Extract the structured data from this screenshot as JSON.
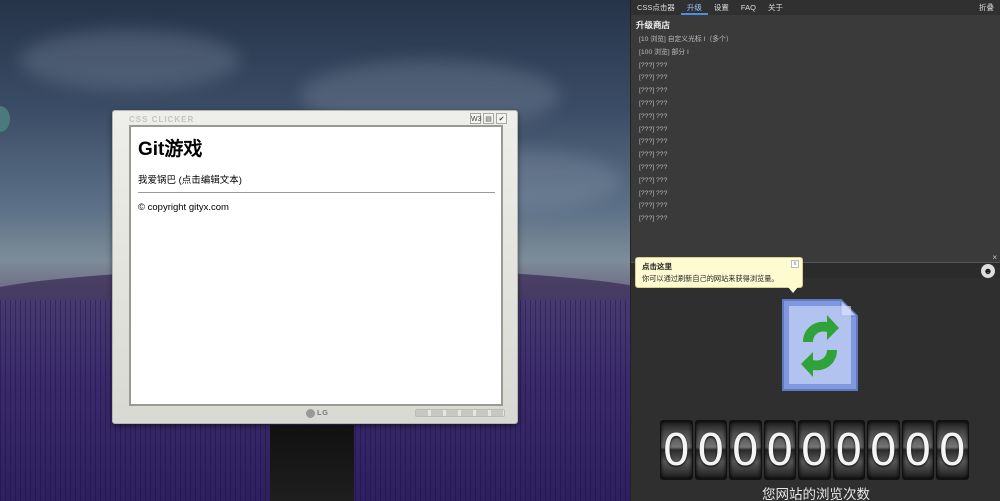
{
  "tabs": [
    {
      "label": "CSS点击器",
      "active": false
    },
    {
      "label": "升级",
      "active": true
    },
    {
      "label": "设置",
      "active": false
    },
    {
      "label": "FAQ",
      "active": false
    },
    {
      "label": "关于",
      "active": false
    }
  ],
  "collapse_label": "折叠",
  "store_title": "升级商店",
  "upgrades": [
    "[10 浏览] 自定义光标 I（多个）",
    "[100 浏览] 部分 I",
    "[???] ???",
    "[???] ???",
    "[???] ???",
    "[???] ???",
    "[???] ???",
    "[???] ???",
    "[???] ???",
    "[???] ???",
    "[???] ???",
    "[???] ???",
    "[???] ???",
    "[???] ???",
    "[???] ???"
  ],
  "monitor": {
    "brand": "CSS CLICKER",
    "logo": "LG",
    "corner_icons": [
      "W3",
      "doc-icon",
      "check-icon"
    ]
  },
  "website": {
    "title": "Git游戏",
    "editable_text": "我爱锅巴 (点击编辑文本)",
    "footer": "© copyright gityx.com"
  },
  "tooltip": {
    "title": "点击这里",
    "body": "你可以通过刷新自己的网站来获得浏览量。",
    "close": "x"
  },
  "counter": {
    "digits": [
      "0",
      "0",
      "0",
      "0",
      "0",
      "0",
      "0",
      "0",
      "0"
    ],
    "label": "您网站的浏览次数"
  },
  "colors": {
    "panel_bg": "#3a3a3a",
    "active_tab": "#4a90e2",
    "tooltip_bg": "#fffbd0",
    "refresh_green": "#2fa33a"
  }
}
